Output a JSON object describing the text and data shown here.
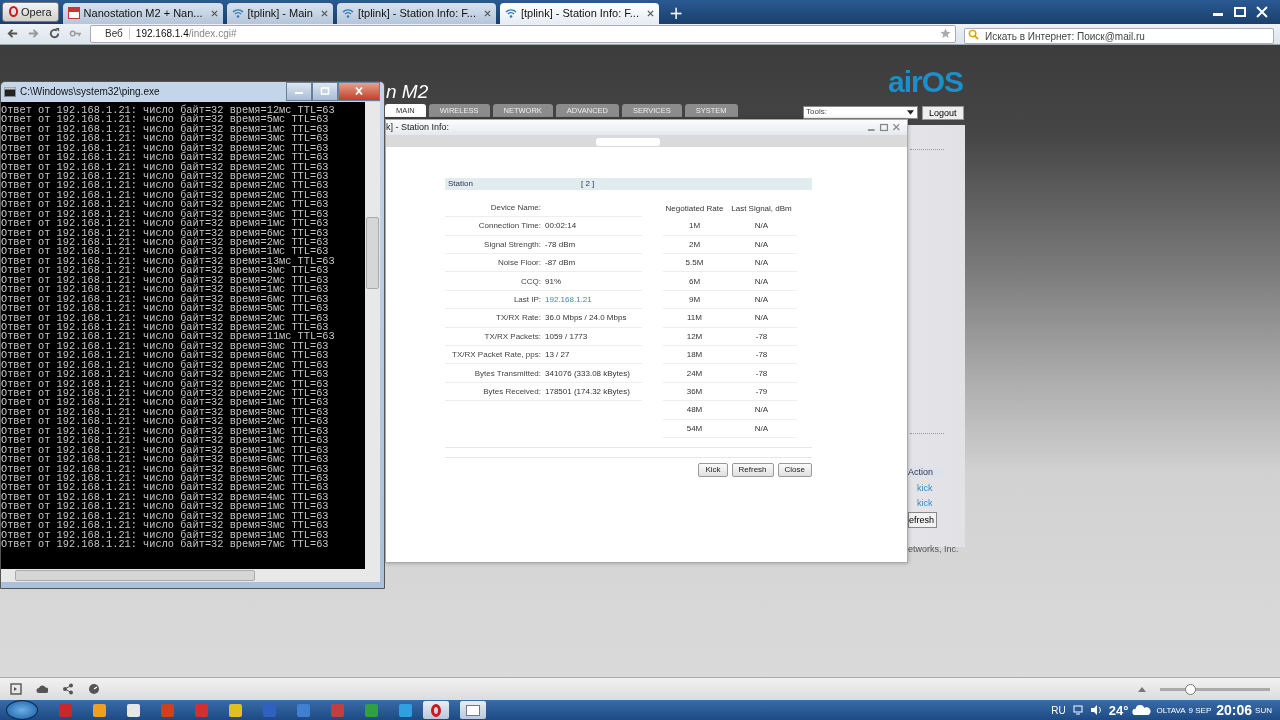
{
  "browser": {
    "menu_button": "Opera",
    "tabs": [
      {
        "label": "Nanostation M2 + Nan...",
        "selected": false
      },
      {
        "label": "[tplink] - Main",
        "selected": false
      },
      {
        "label": "[tplink] - Station Info: F...",
        "selected": false
      },
      {
        "label": "[tplink] - Station Info: F...",
        "selected": true
      }
    ],
    "new_tab": "+",
    "address": {
      "mode": "Веб",
      "host": "192.168.1.4",
      "path": "/index.cgi#"
    },
    "search": {
      "placeholder": "Искать в Интернет: Поиск@mail.ru"
    }
  },
  "background_page": {
    "logo_fragment": "n M2",
    "brand": "airOS",
    "nav_tabs": [
      {
        "label": "MAIN",
        "selected": true
      },
      {
        "label": "WIRELESS",
        "selected": false
      },
      {
        "label": "NETWORK",
        "selected": false
      },
      {
        "label": "ADVANCED",
        "selected": false
      },
      {
        "label": "SERVICES",
        "selected": false
      },
      {
        "label": "SYSTEM",
        "selected": false
      }
    ],
    "tools_select": "Tools:",
    "logout": "Logout",
    "action_header": "Action",
    "action_links": [
      "kick",
      "kick"
    ],
    "refresh_fragment": "efresh",
    "footer_fragment": "etworks, Inc."
  },
  "dialog": {
    "title": "k] - Station Info:",
    "station_label": "Station",
    "station_index": "[ 2 ]",
    "info": [
      {
        "label": "Device Name:"
      },
      {
        "label": "Connection Time:",
        "value": "00:02:14",
        "kind": "text"
      },
      {
        "label": "Signal Strength:",
        "value": "-78 dBm",
        "kind": "text"
      },
      {
        "label": "Noise Floor:",
        "value": "-87 dBm",
        "kind": "text"
      },
      {
        "label": "CCQ:",
        "value": "91%",
        "kind": "text"
      },
      {
        "label": "Last IP:",
        "value": "192.168.1.21",
        "kind": "link"
      },
      {
        "label": "TX/RX Rate:",
        "value": "36.0 Mbps / 24.0 Mbps",
        "kind": "text"
      },
      {
        "label": "TX/RX Packets:",
        "value": "1059 / 1773",
        "kind": "text"
      },
      {
        "label": "TX/RX Packet Rate, pps:",
        "value": "13 / 27",
        "kind": "text"
      },
      {
        "label": "Bytes Transmitted:",
        "value": "341076 (333.08 kBytes)",
        "kind": "text"
      },
      {
        "label": "Bytes Received:",
        "value": "178501 (174.32 kBytes)",
        "kind": "text"
      }
    ],
    "rates_columns": [
      "Negotiated Rate",
      "Last Signal, dBm"
    ],
    "rates": [
      {
        "rate": "1M",
        "signal": "N/A"
      },
      {
        "rate": "2M",
        "signal": "N/A"
      },
      {
        "rate": "5.5M",
        "signal": "N/A"
      },
      {
        "rate": "6M",
        "signal": "N/A"
      },
      {
        "rate": "9M",
        "signal": "N/A"
      },
      {
        "rate": "11M",
        "signal": "N/A"
      },
      {
        "rate": "12M",
        "signal": "-78"
      },
      {
        "rate": "18M",
        "signal": "-78"
      },
      {
        "rate": "24M",
        "signal": "-78"
      },
      {
        "rate": "36M",
        "signal": "-79"
      },
      {
        "rate": "48M",
        "signal": "N/A"
      },
      {
        "rate": "54M",
        "signal": "N/A"
      }
    ],
    "buttons": [
      "Kick",
      "Refresh",
      "Close"
    ]
  },
  "console": {
    "title": "C:\\Windows\\system32\\ping.exe",
    "lines": [
      "Ответ от 192.168.1.21: число байт=32 время=12мс TTL=63",
      "Ответ от 192.168.1.21: число байт=32 время=5мс TTL=63",
      "Ответ от 192.168.1.21: число байт=32 время=1мс TTL=63",
      "Ответ от 192.168.1.21: число байт=32 время=3мс TTL=63",
      "Ответ от 192.168.1.21: число байт=32 время=2мс TTL=63",
      "Ответ от 192.168.1.21: число байт=32 время=2мс TTL=63",
      "Ответ от 192.168.1.21: число байт=32 время=2мс TTL=63",
      "Ответ от 192.168.1.21: число байт=32 время=2мс TTL=63",
      "Ответ от 192.168.1.21: число байт=32 время=2мс TTL=63",
      "Ответ от 192.168.1.21: число байт=32 время=2мс TTL=63",
      "Ответ от 192.168.1.21: число байт=32 время=2мс TTL=63",
      "Ответ от 192.168.1.21: число байт=32 время=3мс TTL=63",
      "Ответ от 192.168.1.21: число байт=32 время=1мс TTL=63",
      "Ответ от 192.168.1.21: число байт=32 время=6мс TTL=63",
      "Ответ от 192.168.1.21: число байт=32 время=2мс TTL=63",
      "Ответ от 192.168.1.21: число байт=32 время=1мс TTL=63",
      "Ответ от 192.168.1.21: число байт=32 время=13мс TTL=63",
      "Ответ от 192.168.1.21: число байт=32 время=3мс TTL=63",
      "Ответ от 192.168.1.21: число байт=32 время=2мс TTL=63",
      "Ответ от 192.168.1.21: число байт=32 время=1мс TTL=63",
      "Ответ от 192.168.1.21: число байт=32 время=6мс TTL=63",
      "Ответ от 192.168.1.21: число байт=32 время=5мс TTL=63",
      "Ответ от 192.168.1.21: число байт=32 время=2мс TTL=63",
      "Ответ от 192.168.1.21: число байт=32 время=2мс TTL=63",
      "Ответ от 192.168.1.21: число байт=32 время=11мс TTL=63",
      "Ответ от 192.168.1.21: число байт=32 время=3мс TTL=63",
      "Ответ от 192.168.1.21: число байт=32 время=6мс TTL=63",
      "Ответ от 192.168.1.21: число байт=32 время=2мс TTL=63",
      "Ответ от 192.168.1.21: число байт=32 время=2мс TTL=63",
      "Ответ от 192.168.1.21: число байт=32 время=2мс TTL=63",
      "Ответ от 192.168.1.21: число байт=32 время=2мс TTL=63",
      "Ответ от 192.168.1.21: число байт=32 время=1мс TTL=63",
      "Ответ от 192.168.1.21: число байт=32 время=8мс TTL=63",
      "Ответ от 192.168.1.21: число байт=32 время=2мс TTL=63",
      "Ответ от 192.168.1.21: число байт=32 время=1мс TTL=63",
      "Ответ от 192.168.1.21: число байт=32 время=1мс TTL=63",
      "Ответ от 192.168.1.21: число байт=32 время=1мс TTL=63",
      "Ответ от 192.168.1.21: число байт=32 время=6мс TTL=63",
      "Ответ от 192.168.1.21: число байт=32 время=6мс TTL=63",
      "Ответ от 192.168.1.21: число байт=32 время=2мс TTL=63",
      "Ответ от 192.168.1.21: число байт=32 время=2мс TTL=63",
      "Ответ от 192.168.1.21: число байт=32 время=4мс TTL=63",
      "Ответ от 192.168.1.21: число байт=32 время=1мс TTL=63",
      "Ответ от 192.168.1.21: число байт=32 время=1мс TTL=63",
      "Ответ от 192.168.1.21: число байт=32 время=3мс TTL=63",
      "Ответ от 192.168.1.21: число байт=32 время=1мс TTL=63",
      "Ответ от 192.168.1.21: число байт=32 время=7мс TTL=63"
    ]
  },
  "status_bar": {
    "zoom_slider": {
      "level": 0.27
    }
  },
  "taskbar": {
    "language": "RU",
    "temperature": "24°",
    "city": "OLTAVA",
    "date": "9 SEP",
    "time": "20:06",
    "weekday": "SUN"
  }
}
